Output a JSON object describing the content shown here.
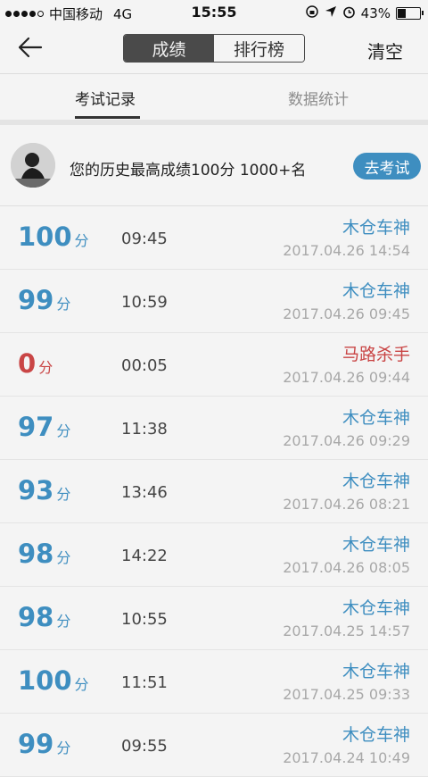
{
  "status_bar": {
    "carrier": "中国移动",
    "network": "4G",
    "time": "15:55",
    "battery_percent": "43%",
    "battery_level": 0.43
  },
  "nav": {
    "segments": [
      "成绩",
      "排行榜"
    ],
    "active_segment": 0,
    "right_action": "清空"
  },
  "tabs": [
    "考试记录",
    "数据统计"
  ],
  "best": {
    "text": "您的历史最高成绩100分  1000+名",
    "button_label": "去考试"
  },
  "records": [
    {
      "score": "100",
      "unit": "分",
      "duration": "09:45",
      "title": "木仓车神",
      "date": "2017.04.26 14:54",
      "color": "#3e8ec0"
    },
    {
      "score": "99",
      "unit": "分",
      "duration": "10:59",
      "title": "木仓车神",
      "date": "2017.04.26 09:45",
      "color": "#3e8ec0"
    },
    {
      "score": "0",
      "unit": "分",
      "duration": "00:05",
      "title": "马路杀手",
      "date": "2017.04.26 09:44",
      "color": "#c94545"
    },
    {
      "score": "97",
      "unit": "分",
      "duration": "11:38",
      "title": "木仓车神",
      "date": "2017.04.26 09:29",
      "color": "#3e8ec0"
    },
    {
      "score": "93",
      "unit": "分",
      "duration": "13:46",
      "title": "木仓车神",
      "date": "2017.04.26 08:21",
      "color": "#3e8ec0"
    },
    {
      "score": "98",
      "unit": "分",
      "duration": "14:22",
      "title": "木仓车神",
      "date": "2017.04.26 08:05",
      "color": "#3e8ec0"
    },
    {
      "score": "98",
      "unit": "分",
      "duration": "10:55",
      "title": "木仓车神",
      "date": "2017.04.25 14:57",
      "color": "#3e8ec0"
    },
    {
      "score": "100",
      "unit": "分",
      "duration": "11:51",
      "title": "木仓车神",
      "date": "2017.04.25 09:33",
      "color": "#3e8ec0"
    },
    {
      "score": "99",
      "unit": "分",
      "duration": "09:55",
      "title": "木仓车神",
      "date": "2017.04.24 10:49",
      "color": "#3e8ec0"
    }
  ],
  "colors": {
    "accent": "#3e8ec0",
    "fail": "#c94545"
  }
}
